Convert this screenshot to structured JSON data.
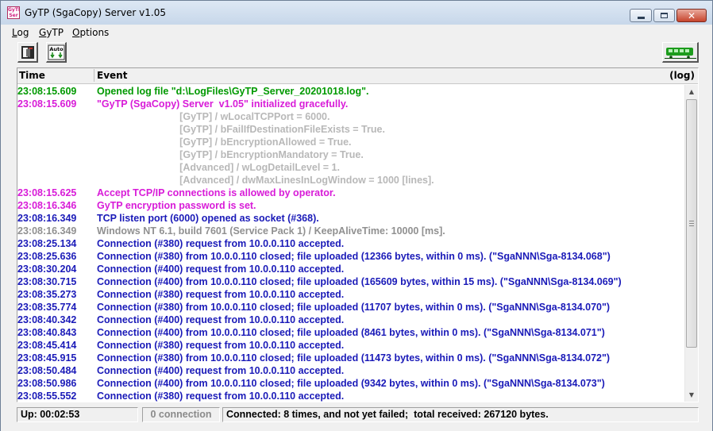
{
  "window": {
    "title": "GyTP (SgaCopy) Server  v1.05",
    "icon_label": "GyTP Ser"
  },
  "menu": [
    {
      "accel": "L",
      "rest": "og"
    },
    {
      "accel": "G",
      "rest": "yTP"
    },
    {
      "accel": "O",
      "rest": "ptions"
    }
  ],
  "toolbar": {
    "buttons": [
      "exit-door-icon",
      "auto-download-icon"
    ],
    "connection_indicator": "train-icon",
    "auto_label": "Auto"
  },
  "grid": {
    "columns": {
      "time": "Time",
      "event": "Event",
      "log": "(log)"
    },
    "rows": [
      {
        "time": "23:08:15.609",
        "event": "Opened log file \"d:\\LogFiles\\GyTP_Server_20201018.log\".",
        "color": "#009900"
      },
      {
        "time": "23:08:15.609",
        "event": "\"GyTP (SgaCopy) Server  v1.05\" initialized gracefully.",
        "color": "#d81bd8"
      },
      {
        "time": "",
        "event": "                              [GyTP] / wLocalTCPPort = 6000.",
        "color": "#b8b8b8"
      },
      {
        "time": "",
        "event": "                              [GyTP] / bFailIfDestinationFileExists = True.",
        "color": "#b8b8b8"
      },
      {
        "time": "",
        "event": "                              [GyTP] / bEncryptionAllowed = True.",
        "color": "#b8b8b8"
      },
      {
        "time": "",
        "event": "                              [GyTP] / bEncryptionMandatory = True.",
        "color": "#b8b8b8"
      },
      {
        "time": "",
        "event": "                              [Advanced] / wLogDetailLevel = 1.",
        "color": "#b8b8b8"
      },
      {
        "time": "",
        "event": "                              [Advanced] / dwMaxLinesInLogWindow = 1000 [lines].",
        "color": "#b8b8b8"
      },
      {
        "time": "23:08:15.625",
        "event": "Accept TCP/IP connections is allowed by operator.",
        "color": "#d81bd8"
      },
      {
        "time": "23:08:16.346",
        "event": "GyTP encryption password is set.",
        "color": "#d81bd8"
      },
      {
        "time": "23:08:16.349",
        "event": "TCP listen port (6000) opened as socket (#368).",
        "color": "#1a1ab8"
      },
      {
        "time": "23:08:16.349",
        "event": "Windows NT 6.1, build 7601 (Service Pack 1) / KeepAliveTime: 10000 [ms].",
        "color": "#909090"
      },
      {
        "time": "23:08:25.134",
        "event": "Connection (#380) request from 10.0.0.110 accepted.",
        "color": "#1a1ab8"
      },
      {
        "time": "23:08:25.636",
        "event": "Connection (#380) from 10.0.0.110 closed; file uploaded (12366 bytes, within 0 ms). (\"SgaNNN\\Sga-8134.068\")",
        "color": "#1a1ab8"
      },
      {
        "time": "23:08:30.204",
        "event": "Connection (#400) request from 10.0.0.110 accepted.",
        "color": "#1a1ab8"
      },
      {
        "time": "23:08:30.715",
        "event": "Connection (#400) from 10.0.0.110 closed; file uploaded (165609 bytes, within 15 ms). (\"SgaNNN\\Sga-8134.069\")",
        "color": "#1a1ab8"
      },
      {
        "time": "23:08:35.273",
        "event": "Connection (#380) request from 10.0.0.110 accepted.",
        "color": "#1a1ab8"
      },
      {
        "time": "23:08:35.774",
        "event": "Connection (#380) from 10.0.0.110 closed; file uploaded (11707 bytes, within 0 ms). (\"SgaNNN\\Sga-8134.070\")",
        "color": "#1a1ab8"
      },
      {
        "time": "23:08:40.342",
        "event": "Connection (#400) request from 10.0.0.110 accepted.",
        "color": "#1a1ab8"
      },
      {
        "time": "23:08:40.843",
        "event": "Connection (#400) from 10.0.0.110 closed; file uploaded (8461 bytes, within 0 ms). (\"SgaNNN\\Sga-8134.071\")",
        "color": "#1a1ab8"
      },
      {
        "time": "23:08:45.414",
        "event": "Connection (#380) request from 10.0.0.110 accepted.",
        "color": "#1a1ab8"
      },
      {
        "time": "23:08:45.915",
        "event": "Connection (#380) from 10.0.0.110 closed; file uploaded (11473 bytes, within 0 ms). (\"SgaNNN\\Sga-8134.072\")",
        "color": "#1a1ab8"
      },
      {
        "time": "23:08:50.484",
        "event": "Connection (#400) request from 10.0.0.110 accepted.",
        "color": "#1a1ab8"
      },
      {
        "time": "23:08:50.986",
        "event": "Connection (#400) from 10.0.0.110 closed; file uploaded (9342 bytes, within 0 ms). (\"SgaNNN\\Sga-8134.073\")",
        "color": "#1a1ab8"
      },
      {
        "time": "23:08:55.552",
        "event": "Connection (#380) request from 10.0.0.110 accepted.",
        "color": "#1a1ab8"
      }
    ]
  },
  "status": {
    "uptime": "Up: 00:02:53",
    "connections": "0 connection",
    "summary": "Connected: 8 times, and not yet failed;  total received: 267120 bytes."
  },
  "colors": {
    "time_column": "#1a1ab8",
    "indicator_green": "#1c9c1c"
  }
}
